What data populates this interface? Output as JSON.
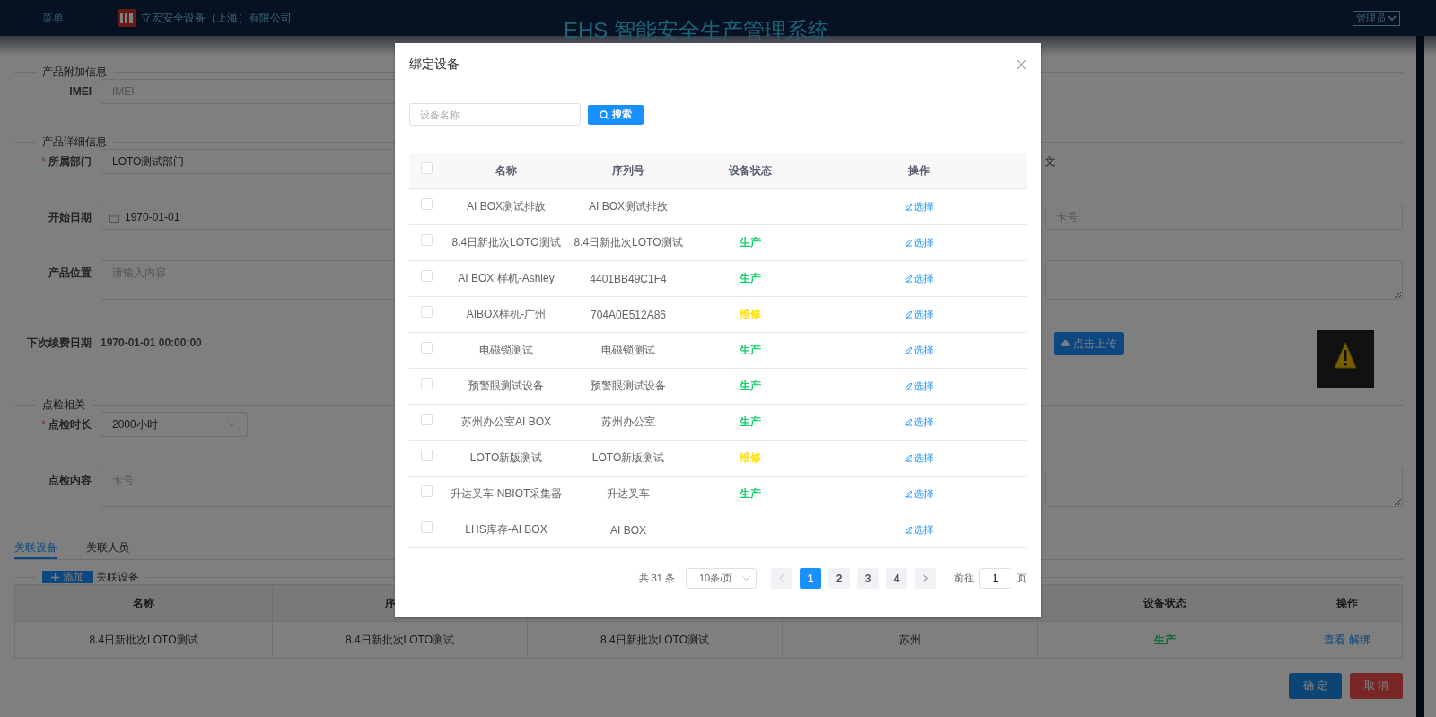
{
  "header": {
    "menu": "菜单",
    "company": "立宏安全设备（上海）有限公司",
    "title": "EHS 智能安全生产管理系统",
    "user": "管理员"
  },
  "form": {
    "required_mark": "*",
    "sections": [
      {
        "legend": "产品附加信息",
        "rows": [
          {
            "label": "IMEI",
            "required": false,
            "kind": "input",
            "placeholder": "IMEI"
          }
        ]
      },
      {
        "legend": "产品详细信息",
        "rows": [
          {
            "label": "所属部门",
            "required": true,
            "kind": "input",
            "value": "LOTO测试部门",
            "right": {
              "kind": "text",
              "value": "文"
            }
          },
          {
            "label": "开始日期",
            "required": false,
            "kind": "date",
            "value": "1970-01-01",
            "right": {
              "kind": "input",
              "placeholder": "卡号"
            }
          },
          {
            "label": "产品位置",
            "required": false,
            "kind": "textarea",
            "placeholder": "请输入内容",
            "right": {
              "kind": "textarea"
            }
          },
          {
            "label": "下次续费日期",
            "required": false,
            "kind": "text",
            "value": "1970-01-01 00:00:00",
            "right": {
              "kind": "upload",
              "button": "点击上传"
            }
          }
        ]
      },
      {
        "legend": "点检相关",
        "rows": [
          {
            "label": "点检时长",
            "required": true,
            "kind": "select",
            "value": "2000小时"
          },
          {
            "label": "点检内容",
            "required": false,
            "kind": "textarea",
            "placeholder": "卡号",
            "right": {
              "kind": "textarea"
            }
          }
        ]
      }
    ]
  },
  "tabs": [
    {
      "label": "关联设备",
      "selected": true
    },
    {
      "label": "关联人员",
      "selected": false
    }
  ],
  "linked": {
    "add": "添加",
    "legend": "关联设备",
    "columns": [
      {
        "label": "名称"
      },
      {
        "label": "序"
      },
      {},
      {},
      {
        "label": "设备状态"
      },
      {
        "label": "操作"
      }
    ],
    "rows": [
      {
        "cells": [
          "8.4日新批次LOTO测试",
          "8.4日新批次LOTO测试",
          "8.4日新批次LOTO测试",
          "苏州"
        ],
        "status": "生产",
        "actions": [
          "查看",
          "解绑"
        ]
      }
    ]
  },
  "buttons": {
    "confirm": "确 定",
    "cancel": "取 消"
  },
  "dialog": {
    "title": "绑定设备",
    "search_placeholder": "设备名称",
    "search_button": "搜索",
    "columns": [
      "名称",
      "序列号",
      "设备状态",
      "操作"
    ],
    "all_checked": false,
    "rows": [
      {
        "checked": false,
        "name": "AI BOX测试排故",
        "serial": "AI BOX测试排故",
        "action": "选择"
      },
      {
        "checked": false,
        "name": "8.4日新批次LOTO测试",
        "serial": "8.4日新批次LOTO测试",
        "status": "生产",
        "color": "#13ce66",
        "action": "选择"
      },
      {
        "checked": false,
        "name": "AI BOX 样机-Ashley",
        "serial": "4401BB49C1F4",
        "status": "生产",
        "color": "#13ce66",
        "action": "选择"
      },
      {
        "checked": false,
        "name": "AIBOX样机-广州",
        "serial": "704A0E512A86",
        "status": "维修",
        "color": "#ffe000",
        "action": "选择"
      },
      {
        "checked": false,
        "name": "电磁锁测试",
        "serial": "电磁锁测试",
        "status": "生产",
        "color": "#13ce66",
        "action": "选择"
      },
      {
        "checked": false,
        "name": "预警眼测试设备",
        "serial": "预警眼测试设备",
        "status": "生产",
        "color": "#13ce66",
        "action": "选择"
      },
      {
        "checked": false,
        "name": "苏州办公室AI BOX",
        "serial": "苏州办公室",
        "status": "生产",
        "color": "#13ce66",
        "action": "选择"
      },
      {
        "checked": false,
        "name": "LOTO新版测试",
        "serial": "LOTO新版测试",
        "status": "维修",
        "color": "#ffe000",
        "action": "选择"
      },
      {
        "checked": false,
        "name": "升达叉车-NBIOT采集器",
        "serial": "升达叉车",
        "status": "生产",
        "color": "#13ce66",
        "action": "选择"
      },
      {
        "checked": false,
        "name": "LHS库存-AI BOX",
        "serial": "AI BOX",
        "action": "选择"
      }
    ],
    "pager": {
      "total": "共 31 条",
      "size": "10条/页",
      "prev_disabled": true,
      "pages": [
        {
          "label": "1",
          "selected": true
        },
        {
          "label": "2",
          "selected": false
        },
        {
          "label": "3",
          "selected": false
        },
        {
          "label": "4",
          "selected": false
        }
      ],
      "goto": "前往",
      "page": "1",
      "unit": "页"
    }
  }
}
